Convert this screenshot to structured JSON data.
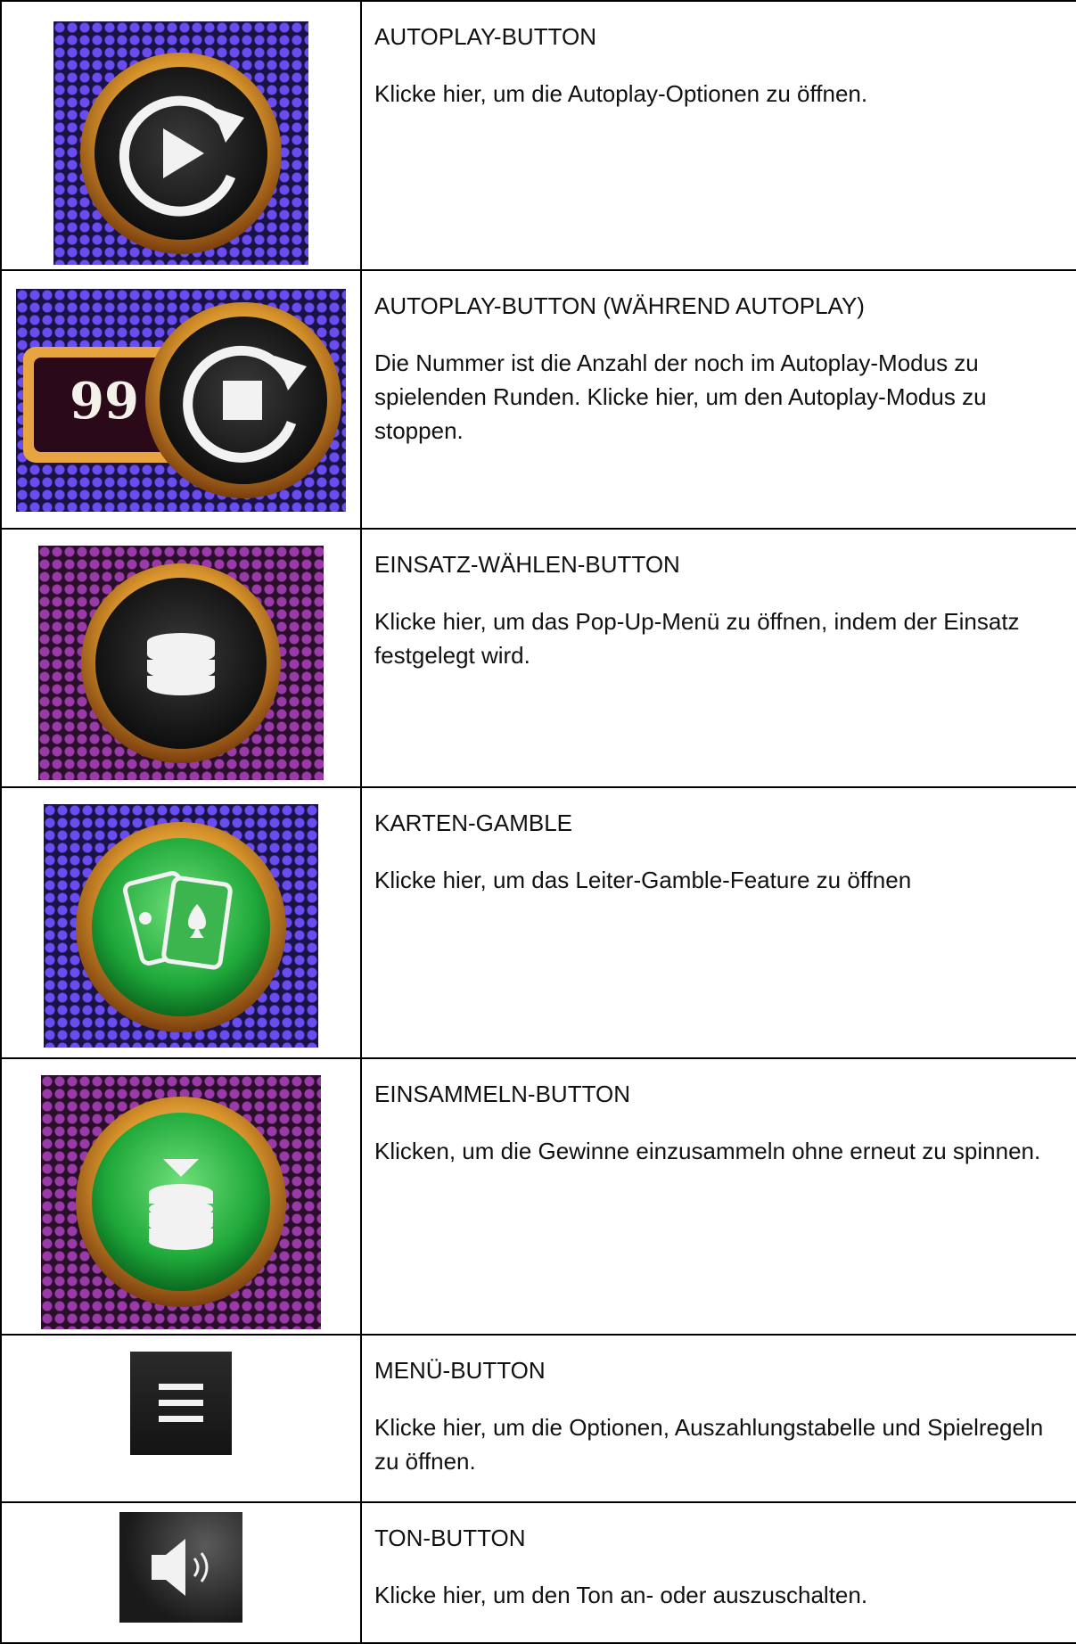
{
  "rows": [
    {
      "title": "AUTOPLAY-BUTTON",
      "description": "Klicke hier, um die Autoplay-Optionen zu öffnen.",
      "icon": "autoplay-icon"
    },
    {
      "title": "AUTOPLAY-BUTTON (WÄHREND AUTOPLAY)",
      "description": "Die Nummer ist die Anzahl der noch im Autoplay-Modus zu spielenden Runden. Klicke hier, um den Autoplay-Modus zu stoppen.",
      "icon": "autoplay-stop-icon",
      "counter": "99"
    },
    {
      "title": "EINSATZ-WÄHLEN-BUTTON",
      "description": "Klicke hier, um das Pop-Up-Menü zu öffnen, indem der Einsatz festgelegt wird.",
      "icon": "coin-stack-icon"
    },
    {
      "title": "KARTEN-GAMBLE",
      "description": "Klicke hier, um das Leiter-Gamble-Feature zu öffnen",
      "icon": "cards-icon"
    },
    {
      "title": "EINSAMMELN-BUTTON",
      "description": "Klicken, um die Gewinne einzusammeln ohne erneut zu spinnen.",
      "icon": "collect-icon"
    },
    {
      "title": "MENÜ-BUTTON",
      "description": "Klicke hier, um die Optionen, Auszahlungstabelle und Spielregeln zu öffnen.",
      "icon": "hamburger-menu-icon"
    },
    {
      "title": "TON-BUTTON",
      "description": "Klicke hier, um den Ton an- oder auszuschalten.",
      "icon": "speaker-icon"
    }
  ],
  "colors": {
    "gold": "#d8942c",
    "green": "#1fa83a",
    "dark": "#1b1b1b",
    "border": "#000000"
  }
}
